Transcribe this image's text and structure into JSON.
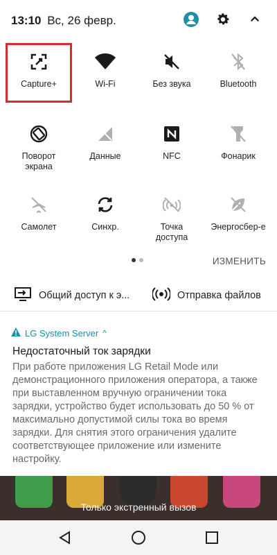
{
  "status": {
    "time": "13:10",
    "date": "Вс, 26 февр."
  },
  "tiles": [
    {
      "label": "Capture+",
      "icon": "capture-plus-icon",
      "active": true
    },
    {
      "label": "Wi-Fi",
      "icon": "wifi-icon",
      "active": true
    },
    {
      "label": "Без звука",
      "icon": "mute-icon",
      "active": true
    },
    {
      "label": "Bluetooth",
      "icon": "bluetooth-icon",
      "active": false
    },
    {
      "label": "Поворот\nэкрана",
      "icon": "rotate-screen-icon",
      "active": true
    },
    {
      "label": "Данные",
      "icon": "mobile-data-icon",
      "active": false
    },
    {
      "label": "NFC",
      "icon": "nfc-icon",
      "active": true
    },
    {
      "label": "Фонарик",
      "icon": "flashlight-icon",
      "active": false
    },
    {
      "label": "Самолет",
      "icon": "airplane-icon",
      "active": false
    },
    {
      "label": "Синхр.",
      "icon": "sync-icon",
      "active": true
    },
    {
      "label": "Точка\nдоступа",
      "icon": "hotspot-icon",
      "active": false
    },
    {
      "label": "Энергосбер-е",
      "icon": "battery-saver-icon",
      "active": false
    }
  ],
  "edit_label": "ИЗМЕНИТЬ",
  "shortcuts": {
    "screen_share": "Общий доступ к э...",
    "file_share": "Отправка файлов"
  },
  "notification": {
    "app": "LG System Server",
    "chevron": "^",
    "title": "Недостаточный ток зарядки",
    "body": "При работе приложения LG Retail Mode или демонстрационного приложения оператора, а также при выставленном вручную ограничении тока зарядки, устройство будет использовать до 50 % от максимально допустимой силы тока во время зарядки. Для снятия этого ограничения удалите соответствующее приложение или измените настройку."
  },
  "lockscreen": {
    "emergency": "Только экстренный вызов"
  },
  "colors": {
    "accent": "#1f8fa8",
    "highlight": "#d62c2c",
    "active_icon": "#1a1a1a",
    "inactive_icon": "#b0b0b0"
  }
}
